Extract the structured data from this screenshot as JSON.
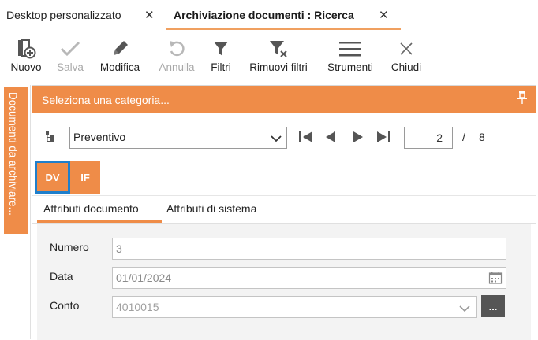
{
  "tabs": [
    {
      "label": "Desktop personalizzato"
    },
    {
      "label": "Archiviazione documenti : Ricerca"
    }
  ],
  "toolbar": {
    "nuovo": "Nuovo",
    "salva": "Salva",
    "modifica": "Modifica",
    "annulla": "Annulla",
    "filtri": "Filtri",
    "rimuovi_filtri": "Rimuovi filtri",
    "strumenti": "Strumenti",
    "chiudi": "Chiudi"
  },
  "side_tab": {
    "label": "Documenti da archiviare..."
  },
  "panel": {
    "title": "Seleziona una categoria...",
    "category": "Preventivo",
    "page_current": "2",
    "page_separator": "/",
    "page_total": "8",
    "doc_types": [
      "DV",
      "IF"
    ],
    "subtabs": [
      "Attributi documento",
      "Attributi di sistema"
    ]
  },
  "form": {
    "numero_label": "Numero",
    "numero_value": "3",
    "data_label": "Data",
    "data_value": "01/01/2024",
    "conto_label": "Conto",
    "conto_value": "4010015",
    "lookup_label": "..."
  },
  "colors": {
    "accent": "#ef8c48",
    "selection_border": "#1e7fcc",
    "disabled_text": "#a8a8a8"
  },
  "icons": [
    "new-document-icon",
    "check-icon",
    "pencil-icon",
    "undo-icon",
    "filter-icon",
    "remove-filter-icon",
    "menu-icon",
    "close-icon",
    "pin-icon",
    "tree-icon",
    "first-page-icon",
    "prev-page-icon",
    "next-page-icon",
    "last-page-icon",
    "calendar-icon",
    "chevron-down-icon"
  ]
}
